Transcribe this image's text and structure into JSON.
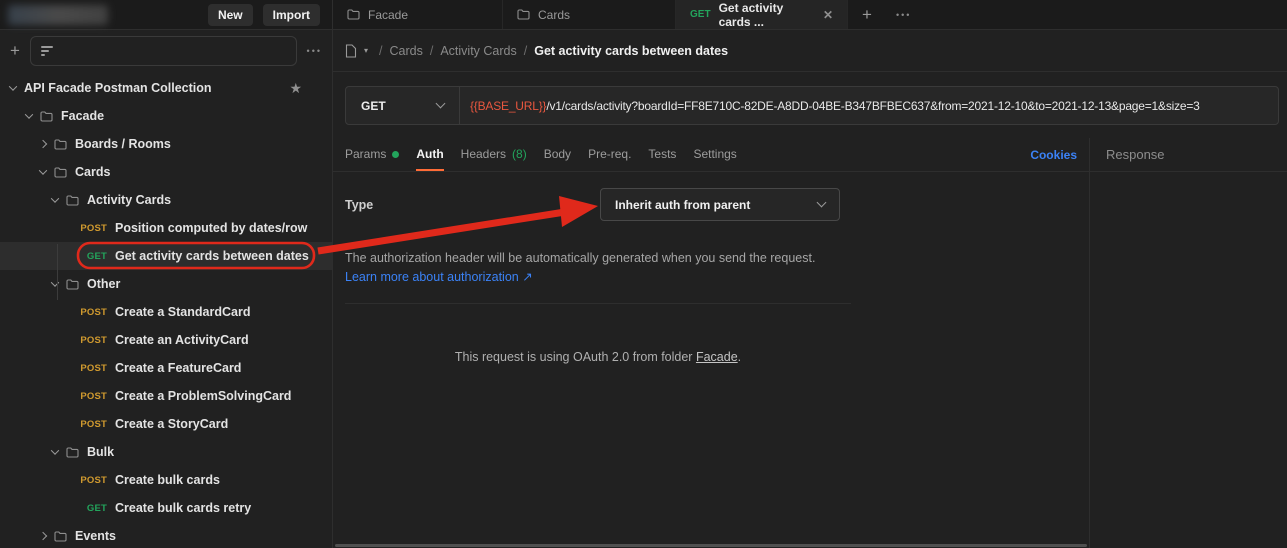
{
  "topbar": {
    "new_label": "New",
    "import_label": "Import",
    "tabs": [
      {
        "label": "Facade"
      },
      {
        "label": "Cards"
      },
      {
        "method": "GET",
        "label": "Get activity cards ..."
      }
    ]
  },
  "icons": {
    "plus": "+",
    "more": "•••",
    "close": "✕",
    "caret": "▾",
    "star": "★",
    "external": "↗"
  },
  "sidebar": {
    "tree": [
      {
        "label": "API Facade Postman Collection"
      },
      {
        "label": "Facade"
      },
      {
        "label": "Boards / Rooms"
      },
      {
        "label": "Cards"
      },
      {
        "label": "Activity Cards"
      },
      {
        "method": "POST",
        "label": "Position computed by dates/row"
      },
      {
        "method": "GET",
        "label": "Get activity cards between dates"
      },
      {
        "label": "Other"
      },
      {
        "method": "POST",
        "label": "Create a StandardCard"
      },
      {
        "method": "POST",
        "label": "Create an ActivityCard"
      },
      {
        "method": "POST",
        "label": "Create a FeatureCard"
      },
      {
        "method": "POST",
        "label": "Create a ProblemSolvingCard"
      },
      {
        "method": "POST",
        "label": "Create a StoryCard"
      },
      {
        "label": "Bulk"
      },
      {
        "method": "POST",
        "label": "Create bulk cards"
      },
      {
        "method": "GET",
        "label": "Create bulk cards retry"
      },
      {
        "label": "Events"
      }
    ]
  },
  "breadcrumb": {
    "sep1": "/",
    "sep2": "/",
    "sep3": "/",
    "parents": [
      "Cards",
      "Activity Cards"
    ],
    "current": "Get activity cards between dates"
  },
  "request": {
    "method": "GET",
    "url_variable": "{{BASE_URL}}",
    "url_path": "/v1/cards/activity?boardId=FF8E710C-82DE-A8DD-04BE-B347BFBEC637&from=2021-12-10&to=2021-12-13&page=1&size=3",
    "tabs": [
      {
        "label": "Params"
      },
      {
        "label": "Auth"
      },
      {
        "label": "Headers",
        "count": "(8)"
      },
      {
        "label": "Body"
      },
      {
        "label": "Pre-req."
      },
      {
        "label": "Tests"
      },
      {
        "label": "Settings"
      }
    ],
    "cookies_label": "Cookies"
  },
  "auth": {
    "type_label": "Type",
    "type_value": "Inherit auth from parent",
    "description": "The authorization header will be automatically generated when you send the request.",
    "link_label": "Learn more about authorization",
    "link_arrow": "↗",
    "oauth_prefix": "This request is using OAuth 2.0 from folder ",
    "oauth_folder": "Facade",
    "oauth_suffix": "."
  },
  "response": {
    "title": "Response"
  },
  "colors": {
    "accent_orange": "#FF6C37",
    "method_get_green": "#23A45C",
    "method_post_amber": "#D09A2F",
    "link_blue": "#3B82F6",
    "url_variable_red": "#E8573F",
    "annotation_red": "#E0291B"
  }
}
